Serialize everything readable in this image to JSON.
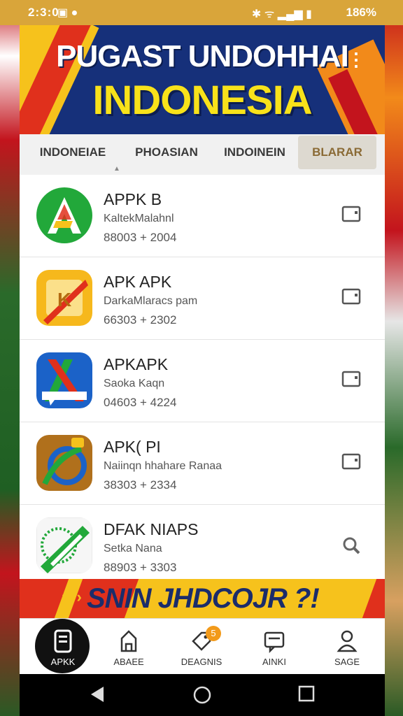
{
  "status_bar": {
    "time": "2:3:0",
    "battery": "186%"
  },
  "header": {
    "title_line1": "PUGAST UNDOHHAI",
    "title_line2": "INDONESIA"
  },
  "tabs": [
    {
      "label": "INDONEIAE"
    },
    {
      "label": "PHOASIAN"
    },
    {
      "label": "INDOINEIN"
    },
    {
      "label": "BLARAR"
    }
  ],
  "apps": [
    {
      "name": "APPK B",
      "subtitle": "KaltekMalahnl",
      "meta": "88003 + 2004",
      "icon": "green-apk-icon"
    },
    {
      "name": "APK APK",
      "subtitle": "DarkaMlaracs pam",
      "meta": "66303 + 2302",
      "icon": "yellow-apk-icon"
    },
    {
      "name": "APKAPK",
      "subtitle": "Saoka Kaqn",
      "meta": "04603 + 4224",
      "icon": "blue-apk-icon"
    },
    {
      "name": "APK( PI",
      "subtitle": "Naiinqn hhahare Ranaa",
      "meta": "38303 + 2334",
      "icon": "brown-apk-icon"
    },
    {
      "name": "DFAK NIAPS",
      "subtitle": "Setka Nana",
      "meta": "88903 + 3303",
      "icon": "white-apk-icon"
    }
  ],
  "promo": {
    "text": "SNIN JHDCOJR ?!"
  },
  "bottom_nav": [
    {
      "label": "APKK",
      "icon": "apk-icon"
    },
    {
      "label": "ABAEE",
      "icon": "home-icon"
    },
    {
      "label": "DEAGNIS",
      "icon": "tag-icon",
      "badge": "5"
    },
    {
      "label": "AINKI",
      "icon": "chat-icon"
    },
    {
      "label": "SAGE",
      "icon": "user-icon"
    }
  ],
  "colors": {
    "header_bg": "#16307a",
    "accent_yellow": "#f8e21a",
    "accent_red": "#e0301c",
    "status_bar": "#d9a53a"
  }
}
